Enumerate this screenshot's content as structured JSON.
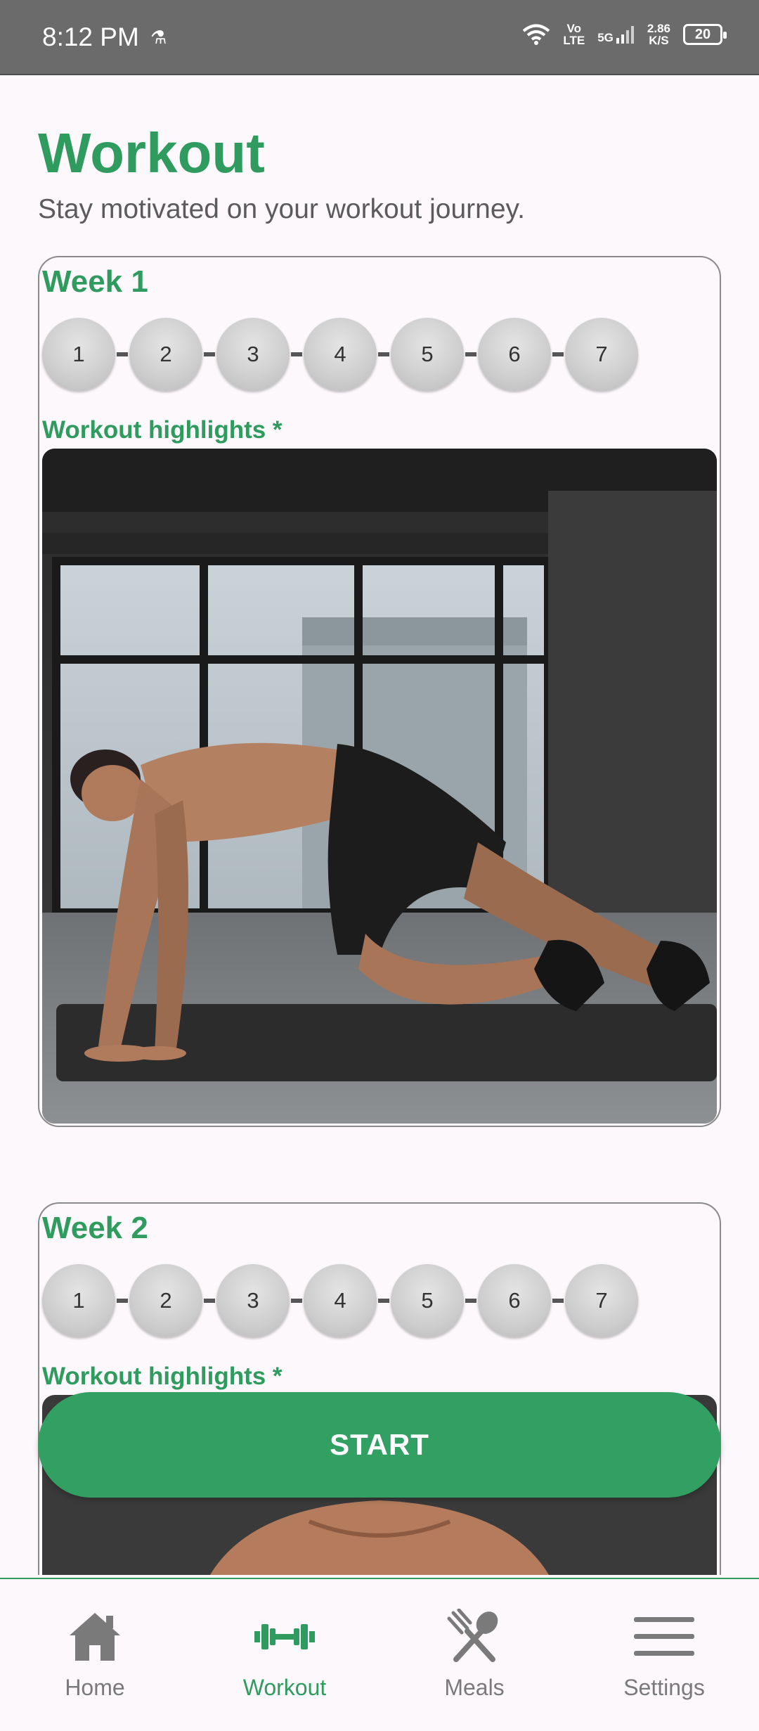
{
  "status_bar": {
    "time": "8:12 PM",
    "net_top": "Vo",
    "net_bottom": "LTE",
    "signal": "5G",
    "speed_top": "2.86",
    "speed_bottom": "K/S",
    "battery": "20"
  },
  "header": {
    "title": "Workout",
    "subtitle": "Stay motivated on your workout journey."
  },
  "weeks": [
    {
      "title": "Week 1",
      "days": [
        "1",
        "2",
        "3",
        "4",
        "5",
        "6",
        "7"
      ],
      "highlights_label": "Workout highlights *"
    },
    {
      "title": "Week 2",
      "days": [
        "1",
        "2",
        "3",
        "4",
        "5",
        "6",
        "7"
      ],
      "highlights_label": "Workout highlights *"
    }
  ],
  "start_button": {
    "label": "START"
  },
  "bottom_nav": {
    "items": [
      {
        "label": "Home",
        "icon": "home-icon"
      },
      {
        "label": "Workout",
        "icon": "dumbbell-icon",
        "active": true
      },
      {
        "label": "Meals",
        "icon": "fork-spoon-icon"
      },
      {
        "label": "Settings",
        "icon": "menu-icon"
      }
    ]
  },
  "colors": {
    "accent": "#2f9b5f",
    "button": "#31a062",
    "status_bar": "#6b6b6b"
  }
}
